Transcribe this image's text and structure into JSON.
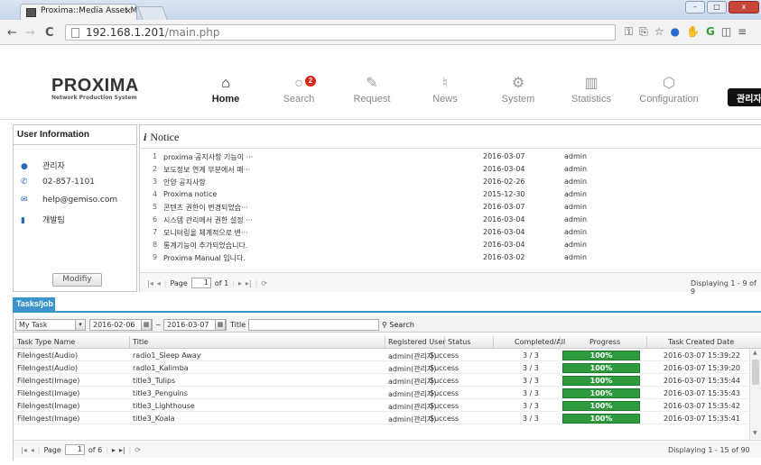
{
  "browser": {
    "tab_title": "Proxima::Media Asset Ma",
    "tab_close": "×",
    "url_host": "192.168.1.201",
    "url_path": "/main.php",
    "back": "←",
    "forward": "→",
    "reload": "C",
    "window_min": "–",
    "window_max": "□",
    "window_close": "x"
  },
  "logo": {
    "name": "PROXIMA",
    "subtitle": "Network Production System"
  },
  "menu": [
    {
      "label": "Home",
      "icon": "home-icon",
      "active": true
    },
    {
      "label": "Search",
      "icon": "search-icon",
      "badge": "2"
    },
    {
      "label": "Request",
      "icon": "edit-icon"
    },
    {
      "label": "News",
      "icon": "microphone-icon"
    },
    {
      "label": "System",
      "icon": "gears-icon"
    },
    {
      "label": "Statistics",
      "icon": "bar-chart-icon"
    },
    {
      "label": "Configuration",
      "icon": "cube-icon"
    }
  ],
  "admin_button": "관리자",
  "user_info": {
    "title": "User Information",
    "name": "관리자",
    "phone": "02-857-1101",
    "email": "help@gemiso.com",
    "team": "개발팀",
    "modify_label": "Modifiy"
  },
  "notice": {
    "title": "Notice",
    "rows": [
      {
        "no": "1",
        "title": "proxima 공지사항 기능이 ···",
        "date": "2016-03-07",
        "author": "admin"
      },
      {
        "no": "2",
        "title": "보도정보 연계 부분에서 매···",
        "date": "2016-03-04",
        "author": "admin"
      },
      {
        "no": "3",
        "title": "안양 공지사항",
        "date": "2016-02-26",
        "author": "admin"
      },
      {
        "no": "4",
        "title": "Proxima notice",
        "date": "2015-12-30",
        "author": "admin"
      },
      {
        "no": "5",
        "title": "콘텐츠 권한이 변경되었습···",
        "date": "2016-03-07",
        "author": "admin"
      },
      {
        "no": "6",
        "title": "시스템 관리에서 권한 설정 ···",
        "date": "2016-03-04",
        "author": "admin"
      },
      {
        "no": "7",
        "title": "모니터링을 체계적으로 변···",
        "date": "2016-03-04",
        "author": "admin"
      },
      {
        "no": "8",
        "title": "통계기능이 추가되었습니다.",
        "date": "2016-03-04",
        "author": "admin"
      },
      {
        "no": "9",
        "title": "Proxima Manual 입니다.",
        "date": "2016-03-02",
        "author": "admin"
      }
    ],
    "pager": {
      "page_label": "Page",
      "page": "1",
      "of": "of 1",
      "display": "Displaying 1 - 9 of 9"
    }
  },
  "tasks": {
    "tab_label": "Tasks/job",
    "filter": {
      "task_select": "My Task",
      "date_from": "2016-02-06",
      "date_sep": "~",
      "date_to": "2016-03-07",
      "title_label": "Title",
      "title_value": "",
      "search_label": "Search"
    },
    "columns": [
      "Task Type Name",
      "Title",
      "Registered User",
      "Status",
      "Completed/All",
      "Progress",
      "Task Created Date"
    ],
    "rows": [
      {
        "type": "FileIngest(Audio)",
        "title": "radio1_Sleep Away",
        "user": "admin(관리자)",
        "status": "Success",
        "completed": "3 / 3",
        "progress": "100%",
        "progress_value": 100,
        "created": "2016-03-07 15:39:22"
      },
      {
        "type": "FileIngest(Audio)",
        "title": "radio1_Kalimba",
        "user": "admin(관리자)",
        "status": "Success",
        "completed": "3 / 3",
        "progress": "100%",
        "progress_value": 100,
        "created": "2016-03-07 15:39:20"
      },
      {
        "type": "FileIngest(Image)",
        "title": "title3_Tulips",
        "user": "admin(관리자)",
        "status": "Success",
        "completed": "3 / 3",
        "progress": "100%",
        "progress_value": 100,
        "created": "2016-03-07 15:35:44"
      },
      {
        "type": "FileIngest(Image)",
        "title": "title3_Penguins",
        "user": "admin(관리자)",
        "status": "Success",
        "completed": "3 / 3",
        "progress": "100%",
        "progress_value": 100,
        "created": "2016-03-07 15:35:43"
      },
      {
        "type": "FileIngest(Image)",
        "title": "title3_Lighthouse",
        "user": "admin(관리자)",
        "status": "Success",
        "completed": "3 / 3",
        "progress": "100%",
        "progress_value": 100,
        "created": "2016-03-07 15:35:42"
      },
      {
        "type": "FileIngest(Image)",
        "title": "title3_Koala",
        "user": "admin(관리자)",
        "status": "Success",
        "completed": "3 / 3",
        "progress": "100%",
        "progress_value": 100,
        "created": "2016-03-07 15:35:41"
      }
    ],
    "pager": {
      "page_label": "Page",
      "page": "1",
      "of": "of 6",
      "display": "Displaying 1 - 15 of 90"
    }
  },
  "colors": {
    "accent_blue": "#3b95cc",
    "progress_green": "#2e9a3e",
    "badge_red": "#d9261c"
  }
}
